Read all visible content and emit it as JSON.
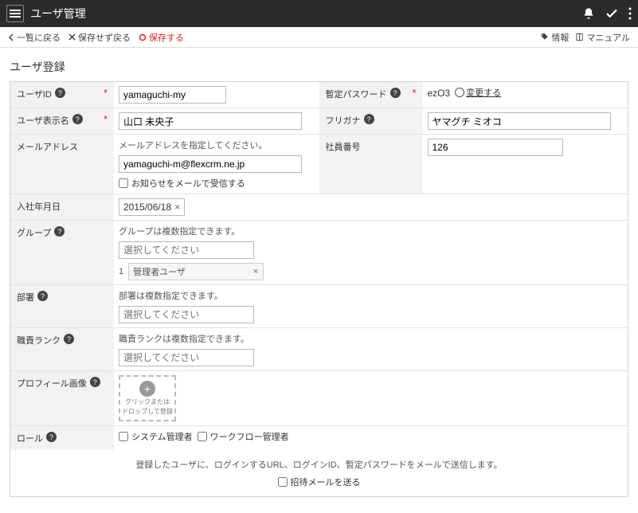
{
  "header": {
    "title": "ユーザ管理"
  },
  "toolbar": {
    "back": "一覧に戻る",
    "discard": "保存せず戻る",
    "save": "保存する",
    "info": "情報",
    "manual": "マニュアル"
  },
  "section_title": "ユーザ登録",
  "labels": {
    "user_id": "ユーザID",
    "display_name": "ユーザ表示名",
    "email": "メールアドレス",
    "join_date": "入社年月日",
    "group": "グループ",
    "department": "部署",
    "rank": "職責ランク",
    "profile_image": "プロフィール画像",
    "role": "ロール",
    "temp_password": "暫定パスワード",
    "furigana": "フリガナ",
    "emp_no": "社員番号"
  },
  "fields": {
    "user_id": "yamaguchi-my",
    "display_name": "山口 未央子",
    "email_note": "メールアドレスを指定してください。",
    "email": "yamaguchi-m@flexcrm.ne.jp",
    "email_optin": "お知らせをメールで受信する",
    "join_date": "2015/06/18",
    "group_note": "グループは複数指定できます。",
    "select_placeholder": "選択してください",
    "group_tag_index": "1",
    "group_tag": "管理者ユーザ",
    "dept_note": "部署は複数指定できます。",
    "rank_note": "職責ランクは複数指定できます。",
    "dropzone_line1": "クリックまたは",
    "dropzone_line2": "ドロップして登録",
    "role_sysadmin": "システム管理者",
    "role_workflow": "ワークフロー管理者",
    "temp_password": "ezO3",
    "change": "変更する",
    "furigana": "ヤマグチ ミオコ",
    "emp_no": "126"
  },
  "footer": {
    "note": "登録したユーザに、ログインするURL、ログインID、暫定パスワードをメールで送信します。",
    "send_invite": "招待メールを送る"
  }
}
